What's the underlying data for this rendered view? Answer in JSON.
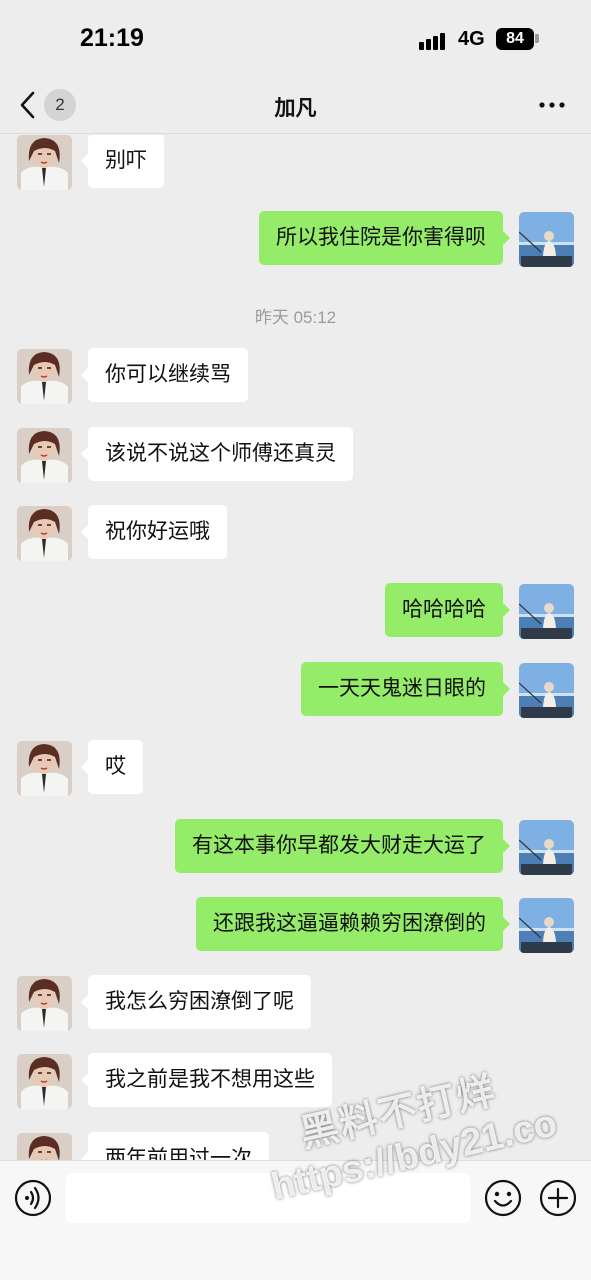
{
  "status_bar": {
    "time": "21:19",
    "network": "4G",
    "battery": "84"
  },
  "nav": {
    "back_badge": "2",
    "title": "加凡",
    "more_icon": "more-dots-icon"
  },
  "messages": [
    {
      "side": "in",
      "text": "别吓"
    },
    {
      "side": "out",
      "text": "所以我住院是你害得呗"
    },
    {
      "type": "time",
      "text": "昨天 05:12"
    },
    {
      "side": "in",
      "text": "你可以继续骂"
    },
    {
      "side": "in",
      "text": "该说不说这个师傅还真灵"
    },
    {
      "side": "in",
      "text": "祝你好运哦"
    },
    {
      "side": "out",
      "text": "哈哈哈哈"
    },
    {
      "side": "out",
      "text": "一天天鬼迷日眼的"
    },
    {
      "side": "in",
      "text": "哎"
    },
    {
      "side": "out",
      "text": "有这本事你早都发大财走大运了"
    },
    {
      "side": "out",
      "text": "还跟我这逼逼赖赖穷困潦倒的"
    },
    {
      "side": "in",
      "text": "我怎么穷困潦倒了呢"
    },
    {
      "side": "in",
      "text": "我之前是我不想用这些"
    },
    {
      "side": "in",
      "text": "两年前用过一次"
    }
  ],
  "input_bar": {
    "placeholder": "",
    "voice_icon": "voice-icon",
    "emoji_icon": "emoji-icon",
    "plus_icon": "plus-icon"
  },
  "watermark": {
    "line1": "黑料不打烊",
    "line2": "https://bdy21.co"
  },
  "colors": {
    "background": "#ededed",
    "outgoing_bubble": "#95ec69",
    "incoming_bubble": "#ffffff"
  }
}
